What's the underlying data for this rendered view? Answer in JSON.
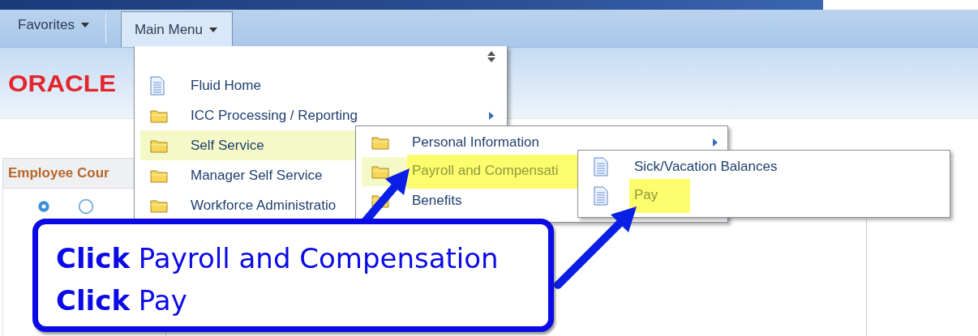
{
  "nav": {
    "tabs": [
      {
        "label": "Favorites",
        "selected": false
      },
      {
        "label": "Main Menu",
        "selected": true
      }
    ]
  },
  "header": {
    "logo": "ORACLE"
  },
  "panel": {
    "title": "Employee Cour"
  },
  "menus": [
    {
      "scroll_arrows": true,
      "items": [
        {
          "label": "Fluid Home",
          "kind": "page",
          "submenu": false,
          "selected": false,
          "marked": false
        },
        {
          "label": "ICC Processing / Reporting",
          "kind": "folder",
          "submenu": true,
          "selected": false,
          "marked": false
        },
        {
          "label": "Self Service",
          "kind": "folder",
          "selected": true,
          "marked": false
        },
        {
          "label": "Manager Self Service",
          "kind": "folder",
          "selected": false,
          "marked": false
        },
        {
          "label": "Workforce Administratio",
          "kind": "folder",
          "selected": false,
          "marked": false
        }
      ]
    },
    {
      "scroll_arrows": false,
      "items": [
        {
          "label": "Personal Information",
          "kind": "folder",
          "submenu": true,
          "selected": false,
          "marked": false
        },
        {
          "label": "Payroll and Compensati",
          "kind": "folder",
          "selected": true,
          "marked": true
        },
        {
          "label": "Benefits",
          "kind": "folder",
          "selected": false,
          "marked": false
        }
      ]
    },
    {
      "scroll_arrows": false,
      "items": [
        {
          "label": "Sick/Vacation Balances",
          "kind": "page",
          "submenu": false,
          "selected": false,
          "marked": false
        },
        {
          "label": "Pay",
          "kind": "page",
          "submenu": false,
          "selected": false,
          "marked": true
        }
      ]
    }
  ],
  "callout": {
    "lines": [
      "**Click** Payroll and Compensation",
      "**Click** Pay"
    ]
  }
}
